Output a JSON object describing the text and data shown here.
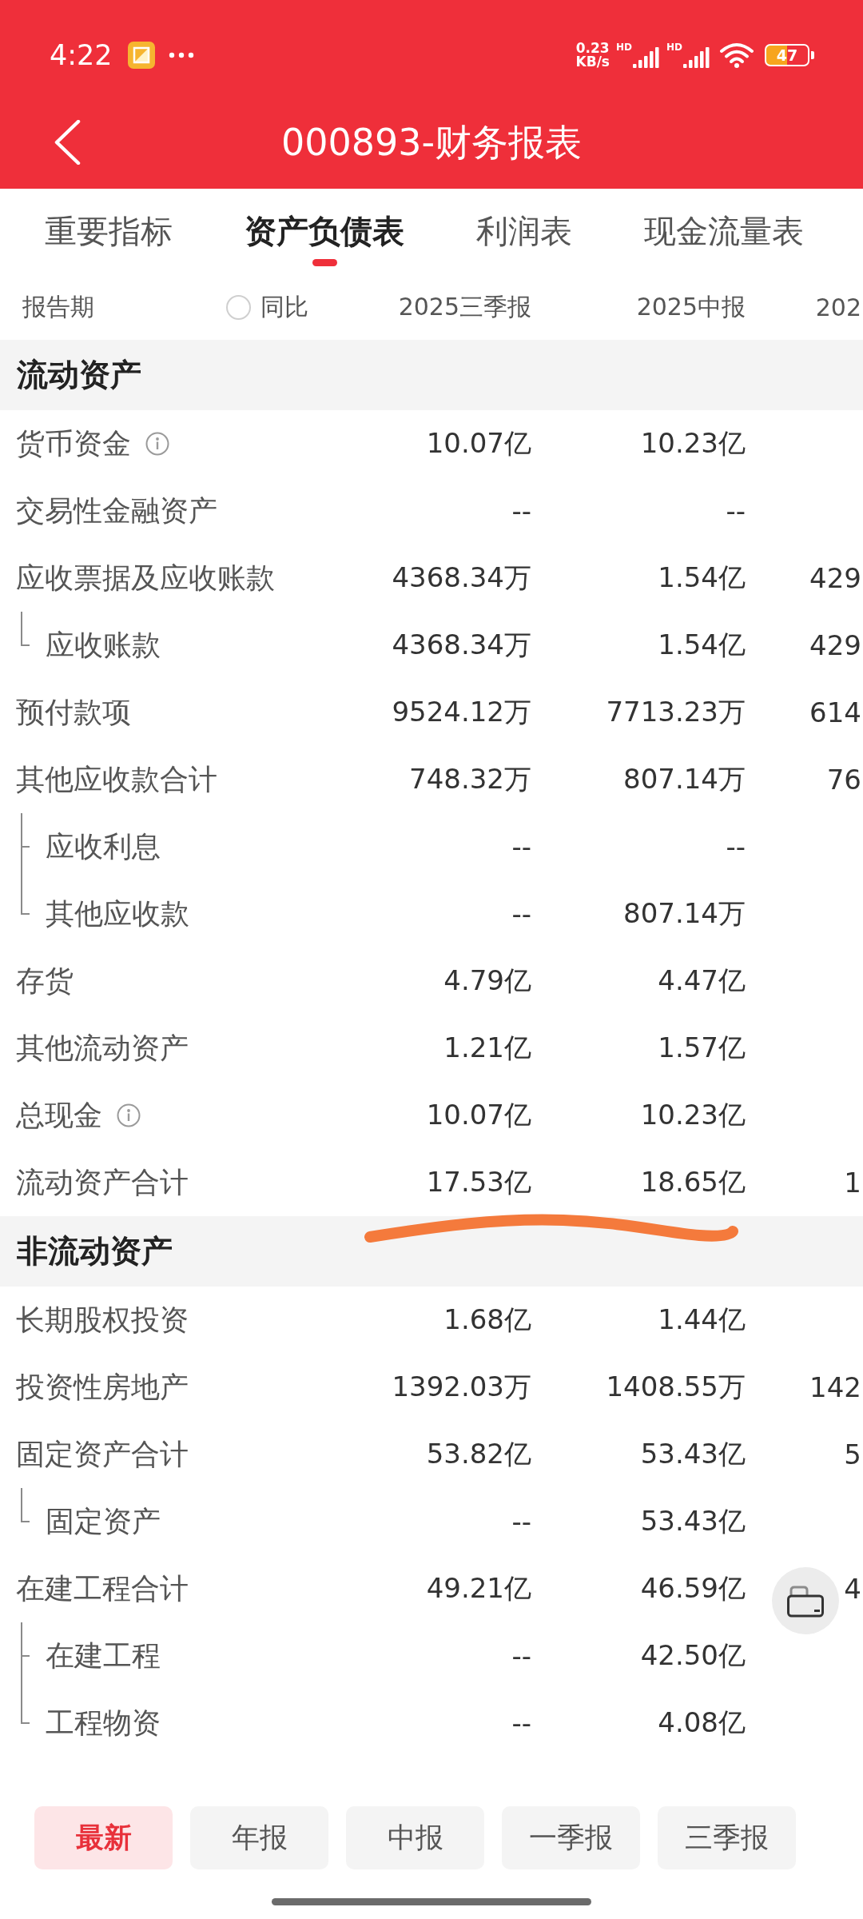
{
  "status_bar": {
    "time": "4:22",
    "speed": [
      "0.23",
      "KB/s"
    ],
    "signals": [
      {
        "label": "HD"
      },
      {
        "label": "HD"
      }
    ],
    "battery": "47"
  },
  "header": {
    "title": "000893-财务报表"
  },
  "tabs": [
    {
      "label": "重要指标",
      "selected": false
    },
    {
      "label": "资产负债表",
      "selected": true
    },
    {
      "label": "利润表",
      "selected": false
    },
    {
      "label": "现金流量表",
      "selected": false
    }
  ],
  "column_header": {
    "label": "报告期",
    "compare": {
      "label": "同比",
      "checked": false
    },
    "columns": [
      "2025三季报",
      "2025中报",
      "202"
    ]
  },
  "sections": [
    {
      "title": "流动资产",
      "rows": [
        {
          "label": "货币资金",
          "info": true,
          "values": [
            "10.07亿",
            "10.23亿"
          ]
        },
        {
          "label": "交易性金融资产",
          "values": [
            "--",
            "--"
          ]
        },
        {
          "label": "应收票据及应收账款",
          "values": [
            "4368.34万",
            "1.54亿",
            "429"
          ],
          "children": [
            {
              "label": "应收账款",
              "values": [
                "4368.34万",
                "1.54亿",
                "429"
              ]
            }
          ]
        },
        {
          "label": "预付款项",
          "values": [
            "9524.12万",
            "7713.23万",
            "614"
          ]
        },
        {
          "label": "其他应收款合计",
          "values": [
            "748.32万",
            "807.14万",
            "76"
          ],
          "children": [
            {
              "label": "应收利息",
              "values": [
                "--",
                "--"
              ]
            },
            {
              "label": "其他应收款",
              "values": [
                "--",
                "807.14万"
              ]
            }
          ]
        },
        {
          "label": "存货",
          "values": [
            "4.79亿",
            "4.47亿"
          ]
        },
        {
          "label": "其他流动资产",
          "values": [
            "1.21亿",
            "1.57亿"
          ]
        },
        {
          "label": "总现金",
          "info": true,
          "values": [
            "10.07亿",
            "10.23亿"
          ]
        },
        {
          "label": "流动资产合计",
          "values": [
            "17.53亿",
            "18.65亿",
            "1"
          ]
        }
      ]
    },
    {
      "title": "非流动资产",
      "rows": [
        {
          "label": "长期股权投资",
          "values": [
            "1.68亿",
            "1.44亿"
          ]
        },
        {
          "label": "投资性房地产",
          "values": [
            "1392.03万",
            "1408.55万",
            "142"
          ]
        },
        {
          "label": "固定资产合计",
          "values": [
            "53.82亿",
            "53.43亿",
            "5"
          ],
          "children": [
            {
              "label": "固定资产",
              "values": [
                "--",
                "53.43亿"
              ]
            }
          ]
        },
        {
          "label": "在建工程合计",
          "values": [
            "49.21亿",
            "46.59亿",
            "4"
          ],
          "children": [
            {
              "label": "在建工程",
              "values": [
                "--",
                "42.50亿"
              ]
            },
            {
              "label": "工程物资",
              "values": [
                "--",
                "4.08亿"
              ]
            }
          ]
        }
      ]
    }
  ],
  "period_buttons": [
    {
      "label": "最新",
      "selected": true
    },
    {
      "label": "年报",
      "selected": false
    },
    {
      "label": "中报",
      "selected": false
    },
    {
      "label": "一季报",
      "selected": false
    },
    {
      "label": "三季报",
      "selected": false
    }
  ]
}
